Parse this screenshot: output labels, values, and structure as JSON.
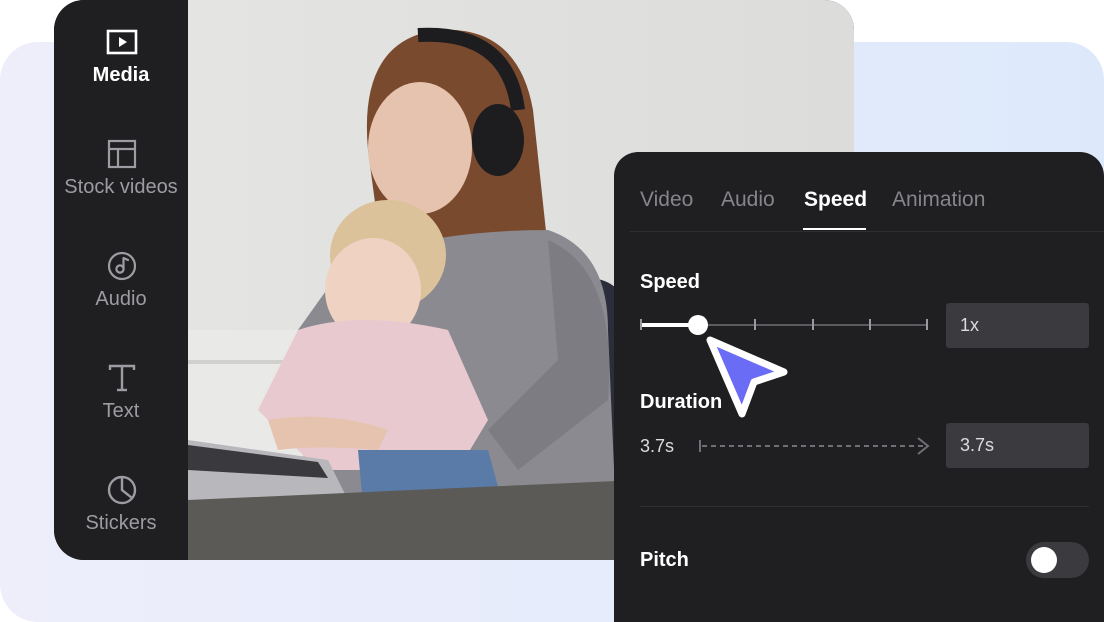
{
  "sidebar": {
    "items": [
      {
        "label": "Media",
        "icon": "play-icon",
        "active": true
      },
      {
        "label": "Stock videos",
        "icon": "layout-icon",
        "active": false
      },
      {
        "label": "Audio",
        "icon": "music-note-icon",
        "active": false
      },
      {
        "label": "Text",
        "icon": "text-icon",
        "active": false
      },
      {
        "label": "Stickers",
        "icon": "sticker-icon",
        "active": false
      }
    ]
  },
  "panel": {
    "tabs": [
      {
        "label": "Video",
        "active": false
      },
      {
        "label": "Audio",
        "active": false
      },
      {
        "label": "Speed",
        "active": true
      },
      {
        "label": "Animation",
        "active": false
      }
    ],
    "speed": {
      "title": "Speed",
      "value": "1x",
      "slider_fraction": 0.2,
      "tick_count": 6
    },
    "duration": {
      "title": "Duration",
      "from": "3.7s",
      "to": "3.7s"
    },
    "pitch": {
      "title": "Pitch",
      "enabled": false
    }
  },
  "colors": {
    "accent": "#6b6cf5",
    "panel_bg": "#1f1f21",
    "field_bg": "#3b3b3f",
    "background_gradient_start": "#eeeefb",
    "background_gradient_end": "#dde9fb"
  }
}
